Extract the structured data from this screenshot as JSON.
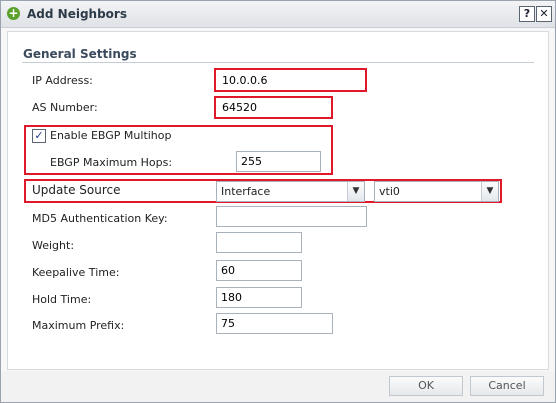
{
  "window": {
    "title": "Add Neighbors",
    "help_label": "?",
    "close_label": "✕"
  },
  "section": {
    "title": "General Settings"
  },
  "fields": {
    "ip_address": {
      "label": "IP Address:",
      "value": "10.0.0.6"
    },
    "as_number": {
      "label": "AS Number:",
      "value": "64520"
    },
    "enable_ebgp_multihop": {
      "label": "Enable EBGP Multihop",
      "checked": true
    },
    "ebgp_max_hops": {
      "label": "EBGP Maximum Hops:",
      "value": "255"
    },
    "update_source": {
      "label": "Update Source",
      "type_value": "Interface",
      "interface_value": "vti0"
    },
    "md5_key": {
      "label": "MD5 Authentication Key:",
      "value": ""
    },
    "weight": {
      "label": "Weight:",
      "value": ""
    },
    "keepalive_time": {
      "label": "Keepalive Time:",
      "value": "60"
    },
    "hold_time": {
      "label": "Hold Time:",
      "value": "180"
    },
    "maximum_prefix": {
      "label": "Maximum Prefix:",
      "value": "75"
    }
  },
  "buttons": {
    "ok": "OK",
    "cancel": "Cancel"
  },
  "colors": {
    "highlight": "#e0192a",
    "title_icon": "#5aa02c"
  }
}
